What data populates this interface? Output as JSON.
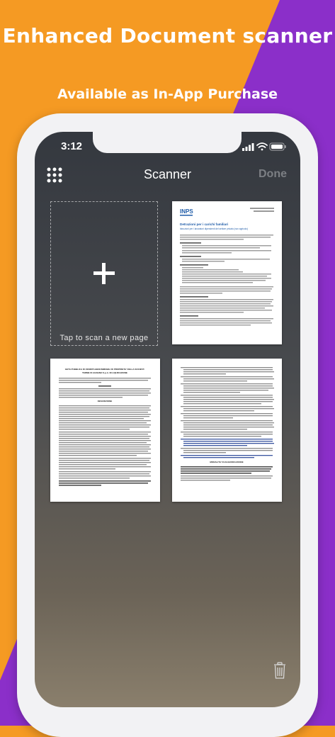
{
  "promo": {
    "headline": "Enhanced Document scanner",
    "subhead": "Available as In-App Purchase"
  },
  "colors": {
    "background_orange": "#f59a23",
    "background_purple": "#8b2fc9",
    "nav_text": "#ffffff",
    "done_disabled": "#7c7f84"
  },
  "status_bar": {
    "time": "3:12",
    "icons": [
      "signal-icon",
      "wifi-icon",
      "battery-icon"
    ]
  },
  "navbar": {
    "left_icon": "grid-icon",
    "title": "Scanner",
    "done_label": "Done"
  },
  "scan_tile": {
    "icon": "plus-icon",
    "label": "Tap to scan a new page"
  },
  "pages": [
    {
      "position": "top-right",
      "logo_text": "INPS",
      "title": "Detrazioni per i carichi familiari",
      "subtitle": "Istruzioni per i lavoratori dipendenti del settore privato (non agricolo)"
    },
    {
      "position": "middle-left",
      "title": "GETA PUBBLICA DI VENDITA BENI IMMOBILI DI PROPRIETA' DELLA SOCIETA'",
      "subtitle": "TERME DI AGNANO S.p.A. IN LIQUIDAZIONE",
      "section": "DESCRIZIONE"
    },
    {
      "position": "middle-right",
      "section": "MODALITA' DI AGGIUDICAZIONE"
    }
  ],
  "toolbar": {
    "trash_icon": "trash-icon"
  }
}
